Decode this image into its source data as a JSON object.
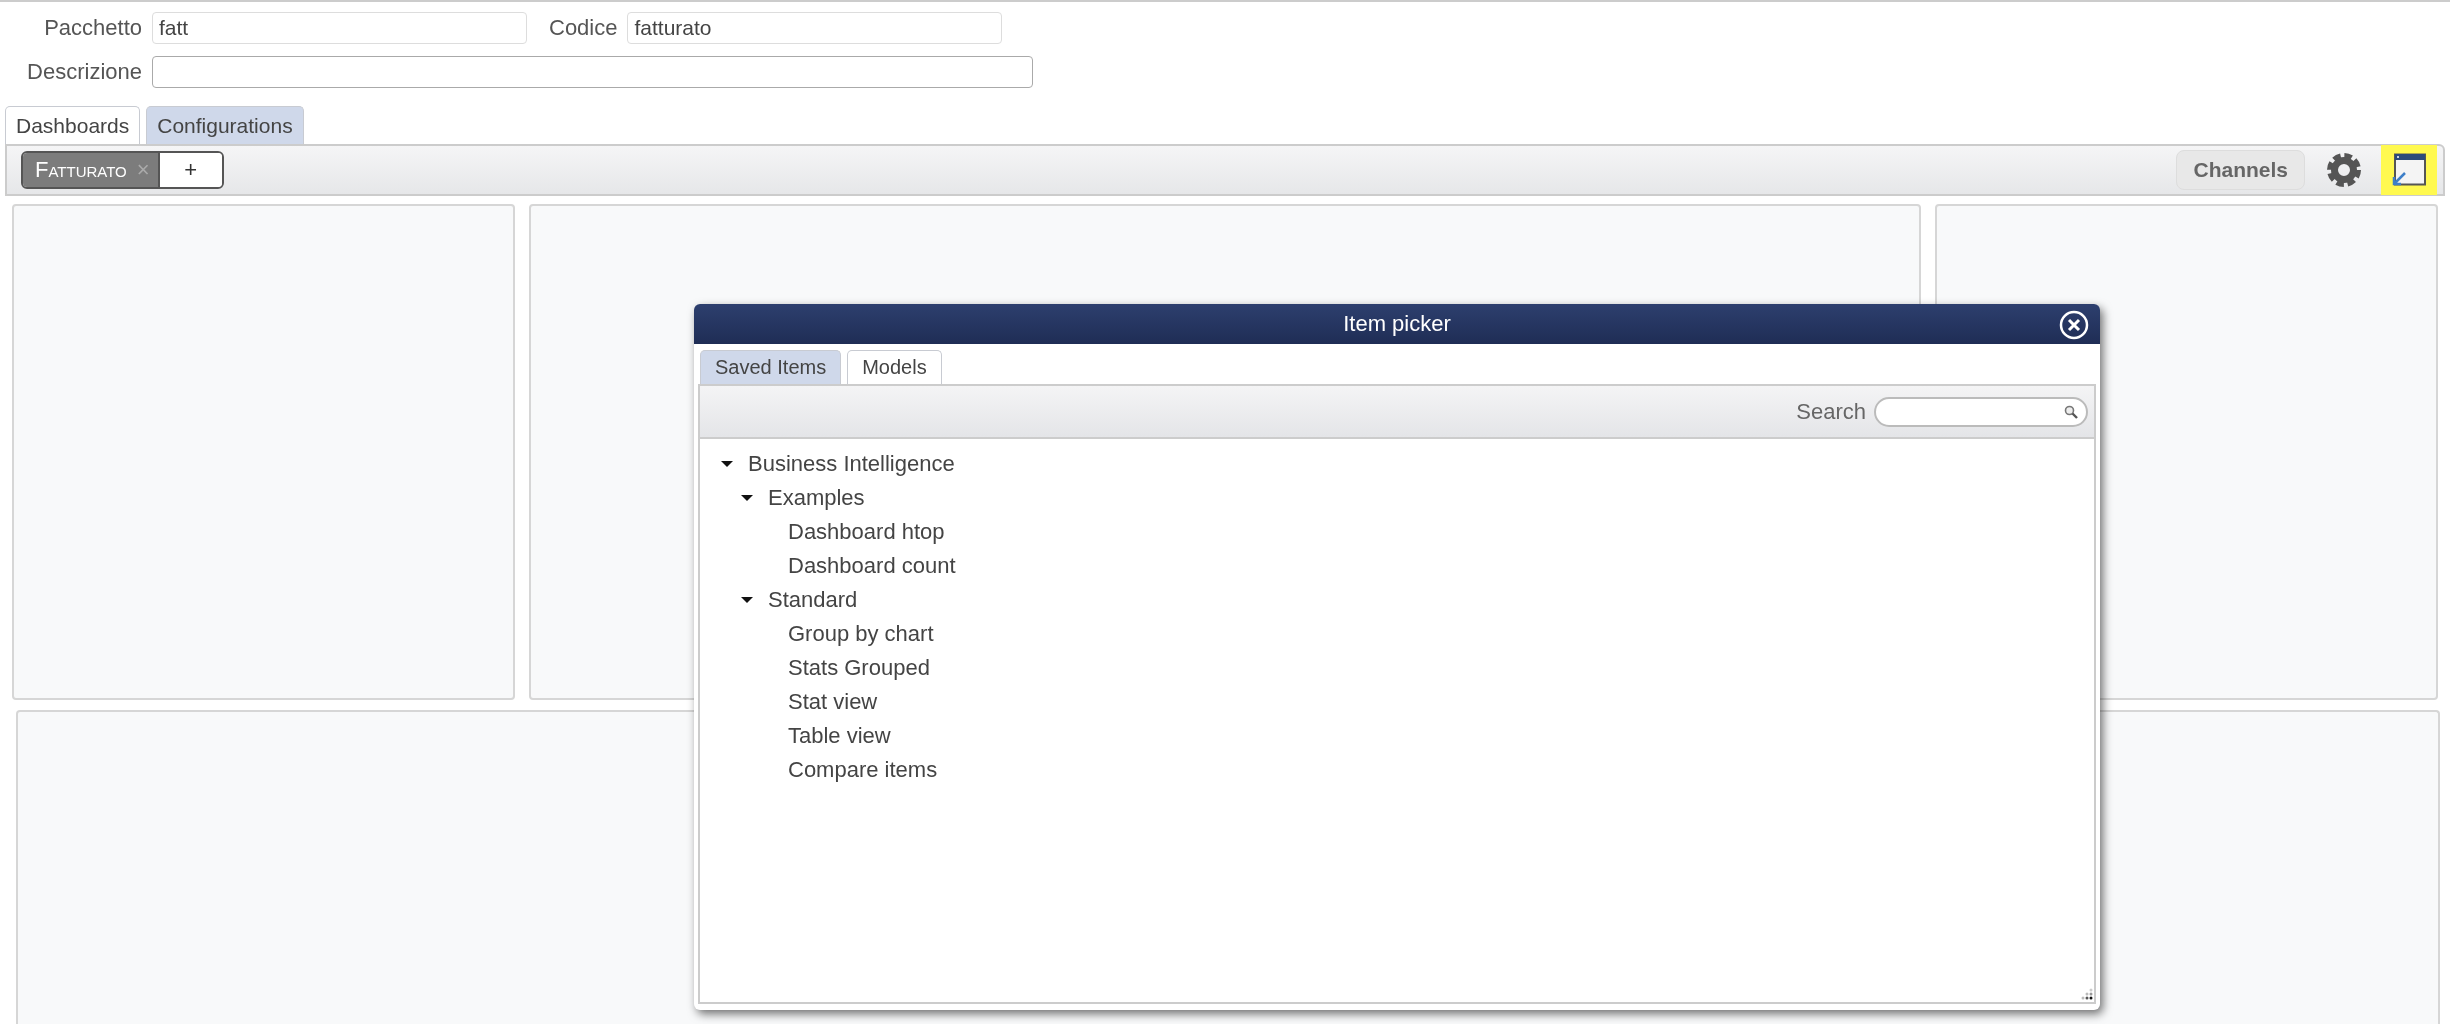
{
  "form": {
    "fields": [
      {
        "label": "Pacchetto",
        "value": "fatt"
      },
      {
        "label": "Codice",
        "value": "fatturato"
      },
      {
        "label": "Descrizione"
      }
    ]
  },
  "tabs": [
    {
      "label": "Dashboards",
      "selected": true
    },
    {
      "label": "Configurations",
      "selected": false
    }
  ],
  "toolbar": {
    "dashboard_tabs": [
      {
        "label": "Fatturato",
        "close": "×",
        "selected": true
      }
    ],
    "add_button": "+",
    "channels_button": "Channels",
    "window_button": {
      "highlighted": true
    }
  },
  "dialog": {
    "title": "Item picker",
    "tabs": [
      {
        "label": "Saved Items",
        "selected": false
      },
      {
        "label": "Models",
        "selected": true
      }
    ],
    "search": {
      "label": "Search"
    },
    "tree": [
      {
        "label": "Business Intelligence",
        "expanded": true,
        "children": [
          {
            "label": "Examples",
            "expanded": true,
            "children": [
              {
                "label": "Dashboard htop"
              },
              {
                "label": "Dashboard count"
              }
            ]
          },
          {
            "label": "Standard",
            "expanded": true,
            "children": [
              {
                "label": "Group by chart"
              },
              {
                "label": "Stats Grouped"
              },
              {
                "label": "Stat view"
              },
              {
                "label": "Table view"
              },
              {
                "label": "Compare items"
              }
            ]
          }
        ]
      }
    ]
  }
}
